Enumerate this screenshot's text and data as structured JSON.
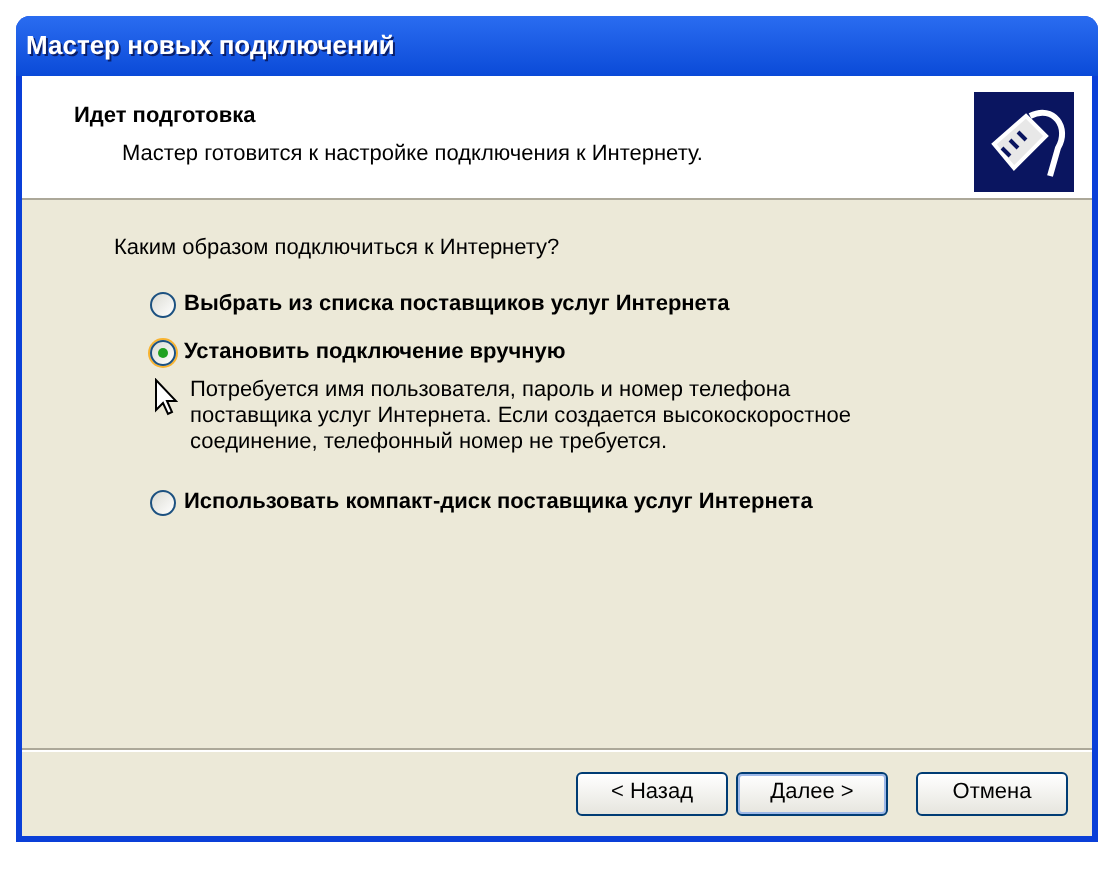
{
  "window": {
    "title": "Мастер новых подключений"
  },
  "header": {
    "title": "Идет подготовка",
    "subtitle": "Мастер готовится к настройке подключения к Интернету."
  },
  "question": "Каким образом подключиться к Интернету?",
  "options": [
    {
      "label": "Выбрать из списка поставщиков услуг Интернета",
      "selected": false
    },
    {
      "label": "Установить подключение вручную",
      "selected": true,
      "description": "Потребуется имя пользователя, пароль и  номер телефона поставщика услуг Интернета. Если создается высокоскоростное соединение, телефонный номер не требуется."
    },
    {
      "label": "Использовать компакт-диск поставщика услуг Интернета",
      "selected": false
    }
  ],
  "buttons": [
    {
      "label": "< Назад",
      "default": false
    },
    {
      "label": "Далее >",
      "default": true
    },
    {
      "label": "Отмена",
      "default": false
    }
  ]
}
